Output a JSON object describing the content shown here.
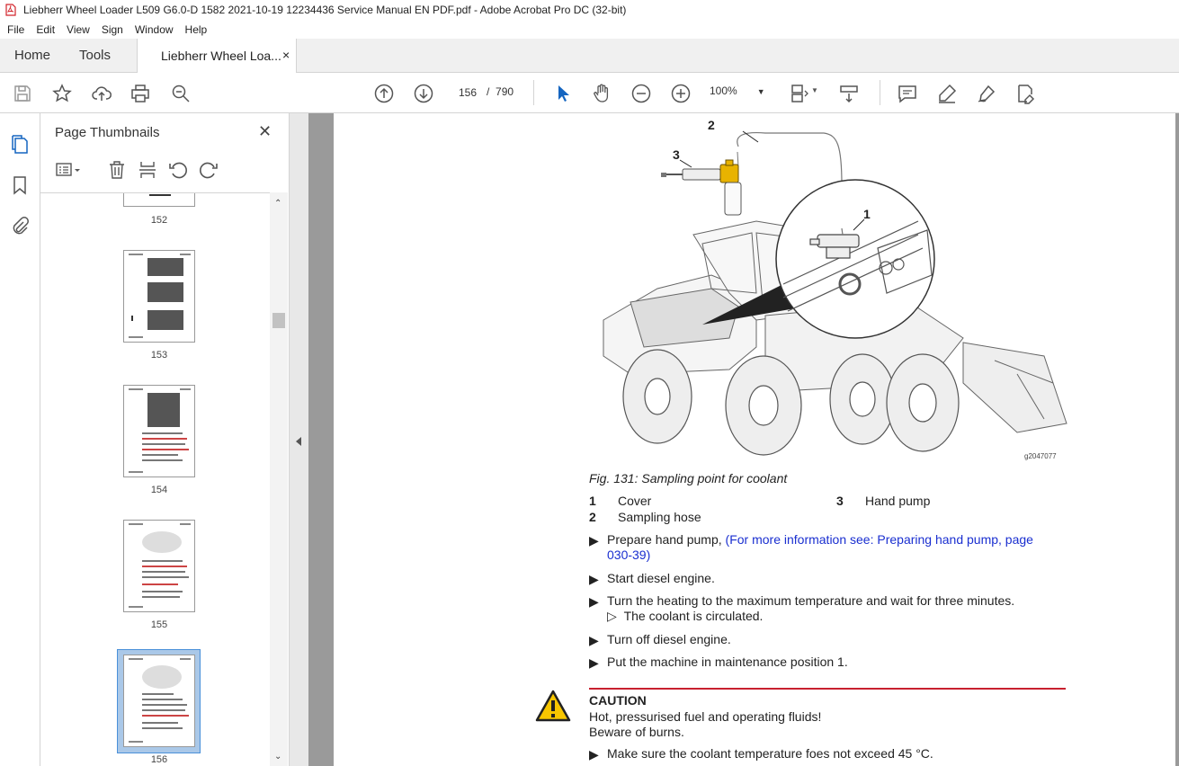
{
  "window": {
    "title": "Liebherr Wheel Loader L509 G6.0-D 1582 2021-10-19 12234436 Service Manual EN PDF.pdf - Adobe Acrobat Pro DC (32-bit)"
  },
  "menu": [
    "File",
    "Edit",
    "View",
    "Sign",
    "Window",
    "Help"
  ],
  "tabs": {
    "home": "Home",
    "tools": "Tools",
    "document": "Liebherr Wheel Loa...",
    "close": "×"
  },
  "toolbar": {
    "current_page": "156",
    "page_sep": "/",
    "total_pages": "790",
    "zoom": "100%"
  },
  "panel": {
    "title": "Page Thumbnails",
    "close": "✕",
    "thumbnails": [
      "152",
      "153",
      "154",
      "155",
      "156"
    ]
  },
  "document": {
    "callouts": [
      "2",
      "3",
      "1"
    ],
    "figure_id": "g2047077",
    "figure_caption": "Fig. 131: Sampling point for coolant",
    "legend": [
      {
        "num": "1",
        "label": "Cover"
      },
      {
        "num": "2",
        "label": "Sampling hose"
      },
      {
        "num": "3",
        "label": "Hand pump"
      }
    ],
    "steps": [
      {
        "text": "Prepare hand pump, ",
        "link": "(For more information see: Preparing hand pump, page 030-39)"
      },
      {
        "text": "Start diesel engine."
      },
      {
        "text": "Turn the heating to the maximum temperature and wait for three minutes.",
        "result": "The coolant is circulated."
      },
      {
        "text": "Turn off diesel engine."
      },
      {
        "text": "Put the machine in maintenance position 1."
      }
    ],
    "caution": {
      "title": "CAUTION",
      "line1": "Hot, pressurised fuel and operating fluids!",
      "line2": "Beware of burns.",
      "step": "Make sure the coolant temperature foes not exceed 45 °C."
    }
  },
  "colors": {
    "accent_blue": "#1a2fd0",
    "caution_red": "#c8202f",
    "selection": "#aac8e8"
  }
}
